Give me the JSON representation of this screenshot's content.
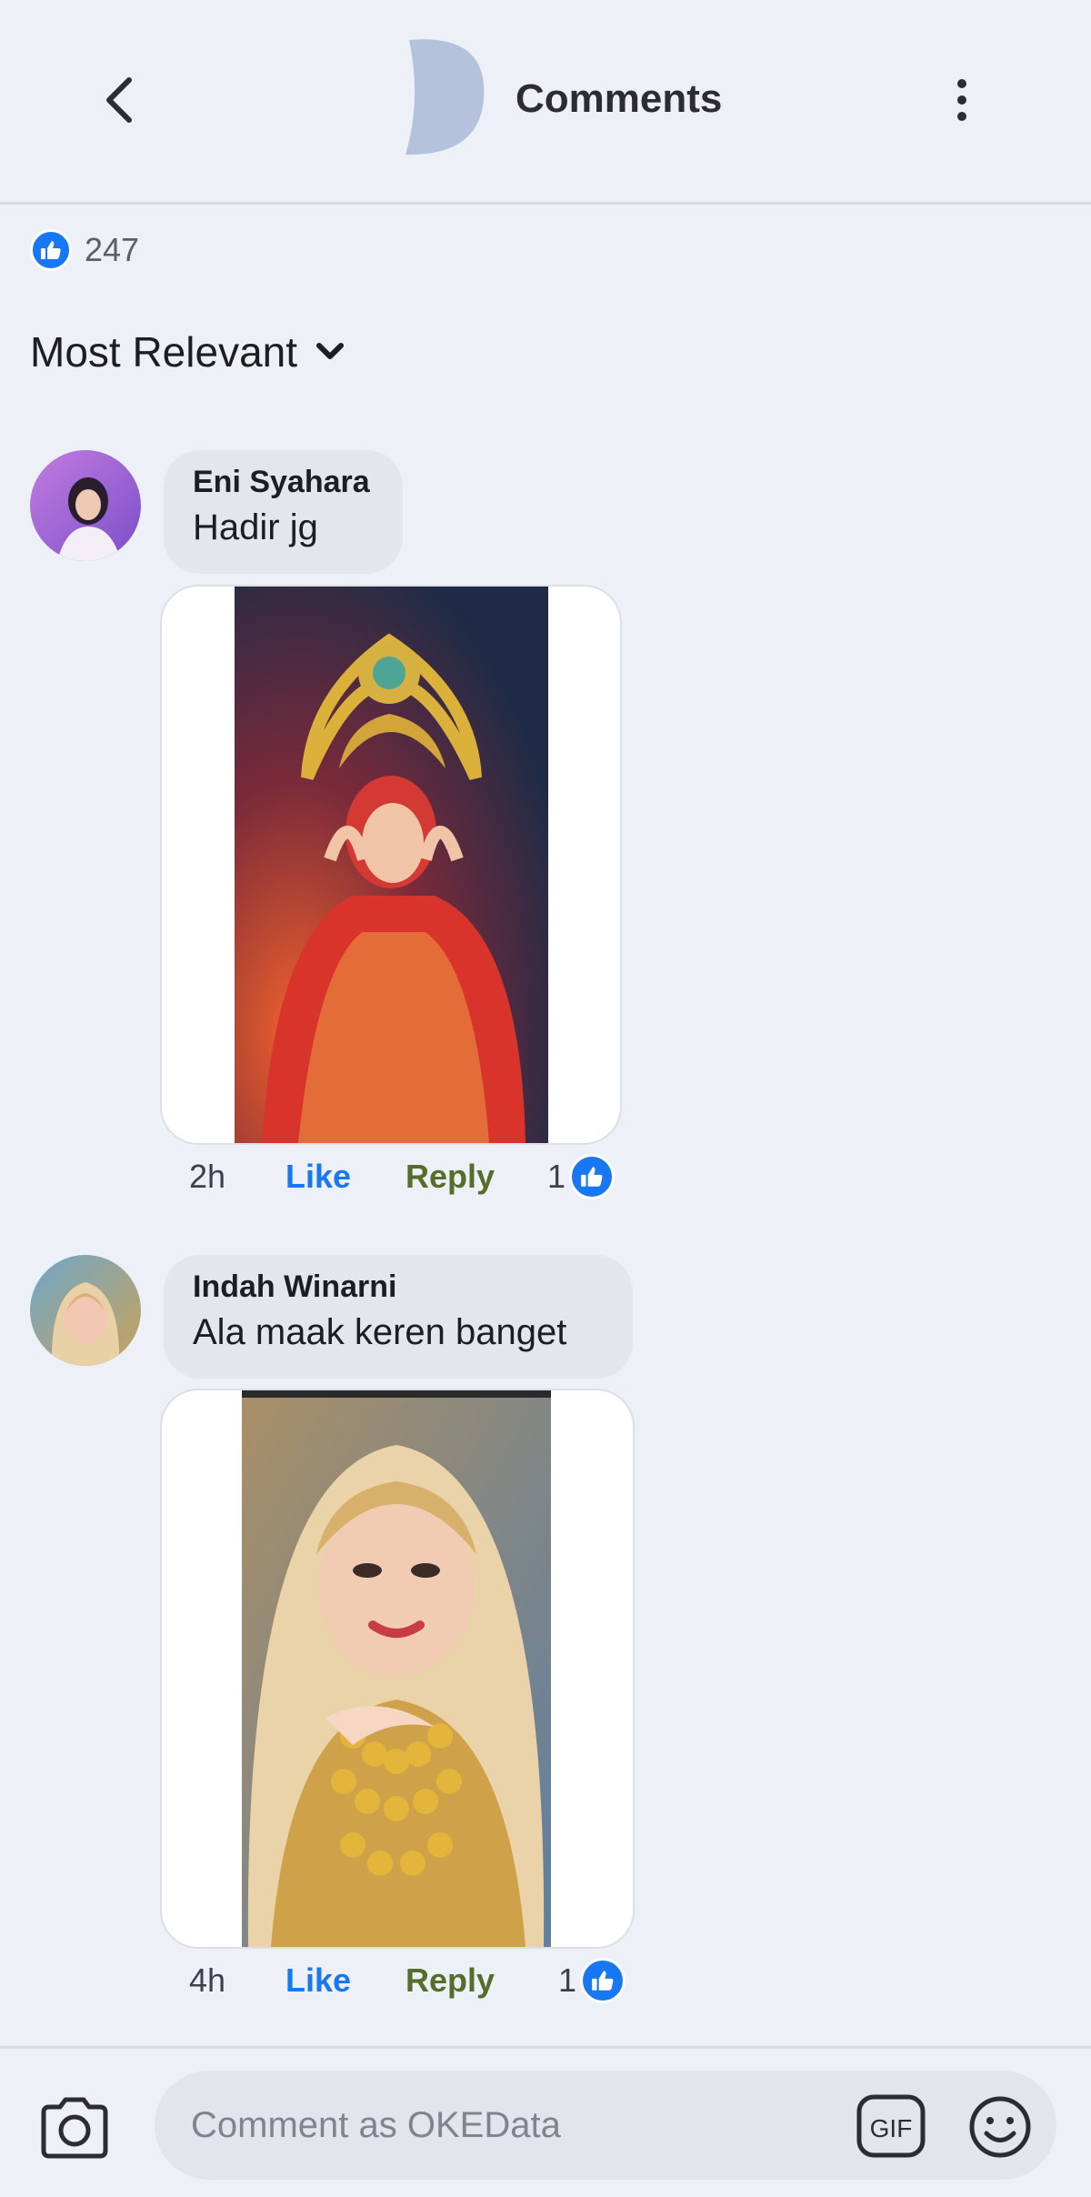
{
  "header": {
    "title": "Comments"
  },
  "reactions": {
    "count": "247"
  },
  "sort": {
    "label": "Most Relevant"
  },
  "comments": [
    {
      "author": "Eni Syahara",
      "text": "Hadir jg",
      "time": "2h",
      "like_label": "Like",
      "reply_label": "Reply",
      "like_count": "1"
    },
    {
      "author": "Indah Winarni",
      "text": "Ala maak keren banget",
      "time": "4h",
      "like_label": "Like",
      "reply_label": "Reply",
      "like_count": "1"
    }
  ],
  "composer": {
    "placeholder": "Comment as OKEData",
    "gif_label": "GIF"
  },
  "colors": {
    "accent": "#1877f2",
    "reply": "#566d2c",
    "background": "#eef0f7",
    "bubble": "#e4e6ec"
  },
  "icons": [
    "back-arrow-icon",
    "page-avatar-icon",
    "more-vertical-icon",
    "like-thumb-icon",
    "chevron-down-icon",
    "camera-icon",
    "gif-icon",
    "emoji-icon"
  ]
}
